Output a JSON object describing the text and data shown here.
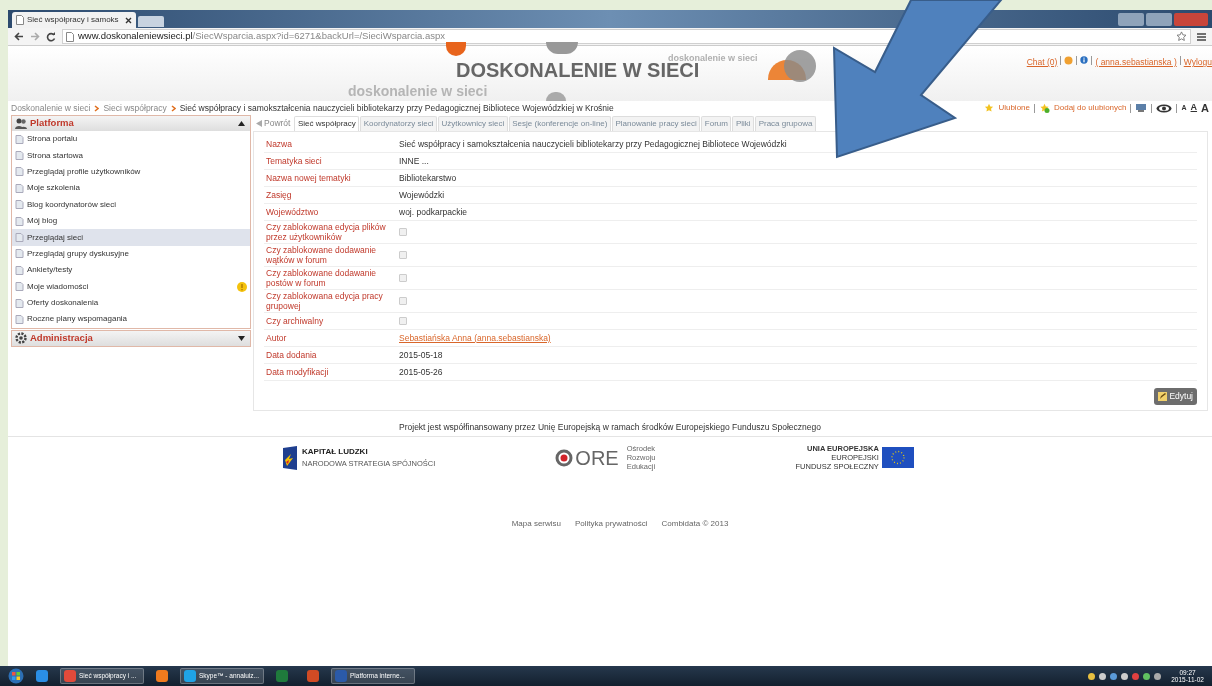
{
  "browser": {
    "tab_title": "Sieć współpracy i samoks",
    "url_host": "www.doskonaleniewsieci.pl",
    "url_path": "/SiecWsparcia.aspx?id=6271&backUrl=/SieciWsparcia.aspx"
  },
  "header": {
    "logo_title": "DOSKONALENIE W SIECI",
    "tagline": "doskonalenie w sieci",
    "small_tagline": "doskonalenie w sieci",
    "user_links": [
      "Chat (0)",
      "( anna.sebastianska )",
      "Wylogu"
    ]
  },
  "breadcrumb": [
    "Doskonalenie w sieci",
    "Sieci współpracy",
    "Sieć współpracy i samokształcenia nauczycieli bibliotekarzy przy Pedagogicznej Bibliotece Wojewódzkiej w Krośnie"
  ],
  "tools": {
    "favorites": "Ulubione",
    "add_favorite": "Dodaj do ulubionych",
    "font_sizes": [
      "A",
      "A",
      "A"
    ]
  },
  "sidebar": [
    {
      "title": "Platforma",
      "expanded": true,
      "items": [
        {
          "label": "Strona portalu",
          "selected": false
        },
        {
          "label": "Strona startowa",
          "selected": false
        },
        {
          "label": "Przeglądaj profile użytkowników",
          "selected": false
        },
        {
          "label": "Moje szkolenia",
          "selected": false
        },
        {
          "label": "Blog koordynatorów sieci",
          "selected": false
        },
        {
          "label": "Mój blog",
          "selected": false
        },
        {
          "label": "Przeglądaj sieci",
          "selected": true
        },
        {
          "label": "Przeglądaj grupy dyskusyjne",
          "selected": false
        },
        {
          "label": "Ankiety/testy",
          "selected": false
        },
        {
          "label": "Moje wiadomości",
          "selected": false,
          "alert": true
        },
        {
          "label": "Oferty doskonalenia",
          "selected": false
        },
        {
          "label": "Roczne plany wspomagania",
          "selected": false
        }
      ]
    },
    {
      "title": "Administracja",
      "expanded": false
    }
  ],
  "tabs": [
    {
      "label": "Powrót",
      "kind": "back"
    },
    {
      "label": "Sieć współpracy",
      "kind": "tab",
      "selected": true
    },
    {
      "label": "Koordynatorzy sieci",
      "kind": "tab",
      "selected": false
    },
    {
      "label": "Użytkownicy sieci",
      "kind": "tab",
      "selected": false
    },
    {
      "label": "Sesje (konferencje on-line)",
      "kind": "tab",
      "selected": false
    },
    {
      "label": "Planowanie pracy sieci",
      "kind": "tab",
      "selected": false
    },
    {
      "label": "Forum",
      "kind": "tab",
      "selected": false
    },
    {
      "label": "Pliki",
      "kind": "tab",
      "selected": false
    },
    {
      "label": "Praca grupowa",
      "kind": "tab",
      "selected": false
    }
  ],
  "fields": [
    {
      "label": "Nazwa",
      "kind": "text",
      "value": "Sieć współpracy i samokształcenia nauczycieli bibliotekarzy przy Pedagogicznej Bibliotece Wojewódzki"
    },
    {
      "label": "Tematyka sieci",
      "kind": "text",
      "value": "INNE ..."
    },
    {
      "label": "Nazwa nowej tematyki",
      "kind": "text",
      "value": "Bibliotekarstwo"
    },
    {
      "label": "Zasięg",
      "kind": "text",
      "value": "Wojewódzki"
    },
    {
      "label": "Województwo",
      "kind": "text",
      "value": "woj. podkarpackie"
    },
    {
      "label": "Czy zablokowana edycja plików przez użytkowników",
      "kind": "checkbox",
      "checked": false
    },
    {
      "label": "Czy zablokowane dodawanie wątków w forum",
      "kind": "checkbox",
      "checked": false
    },
    {
      "label": "Czy zablokowane dodawanie postów w forum",
      "kind": "checkbox",
      "checked": false
    },
    {
      "label": "Czy zablokowana edycja pracy grupowej",
      "kind": "checkbox",
      "checked": false
    },
    {
      "label": "Czy archiwalny",
      "kind": "checkbox",
      "checked": false
    },
    {
      "label": "Autor",
      "kind": "link",
      "value": "Sebastiańska Anna (anna.sebastianska)"
    },
    {
      "label": "Data dodania",
      "kind": "text",
      "value": "2015-05-18"
    },
    {
      "label": "Data modyfikacji",
      "kind": "text",
      "value": "2015-05-26"
    }
  ],
  "edit_button": "Edytuj",
  "footer": {
    "note": "Projekt jest współfinansowany przez Unię Europejską w ramach środków Europejskiego Funduszu Społecznego",
    "kl_title": "KAPITAŁ LUDZKI",
    "kl_subtitle": "NARODOWA STRATEGIA SPÓJNOŚCI",
    "ore": "ORE",
    "ore_lines": [
      "Ośrodek",
      "Rozwoju",
      "Edukacji"
    ],
    "eu_lines": [
      "UNIA EUROPEJSKA",
      "EUROPEJSKI",
      "FUNDUSZ SPOŁECZNY"
    ],
    "links": [
      "Mapa serwisu",
      "Polityka prywatności",
      "Combidata © 2013"
    ]
  },
  "taskbar": {
    "items": [
      {
        "kind": "ie"
      },
      {
        "kind": "chrome",
        "label": "Sieć współpracy i ..."
      },
      {
        "kind": "firefox"
      },
      {
        "kind": "skype",
        "label": "Skype™ - annaluiz..."
      },
      {
        "kind": "excel"
      },
      {
        "kind": "powerpoint"
      },
      {
        "kind": "word",
        "label": "Platforma interne..."
      }
    ],
    "time": "09:27",
    "date": "2015-11-02"
  }
}
